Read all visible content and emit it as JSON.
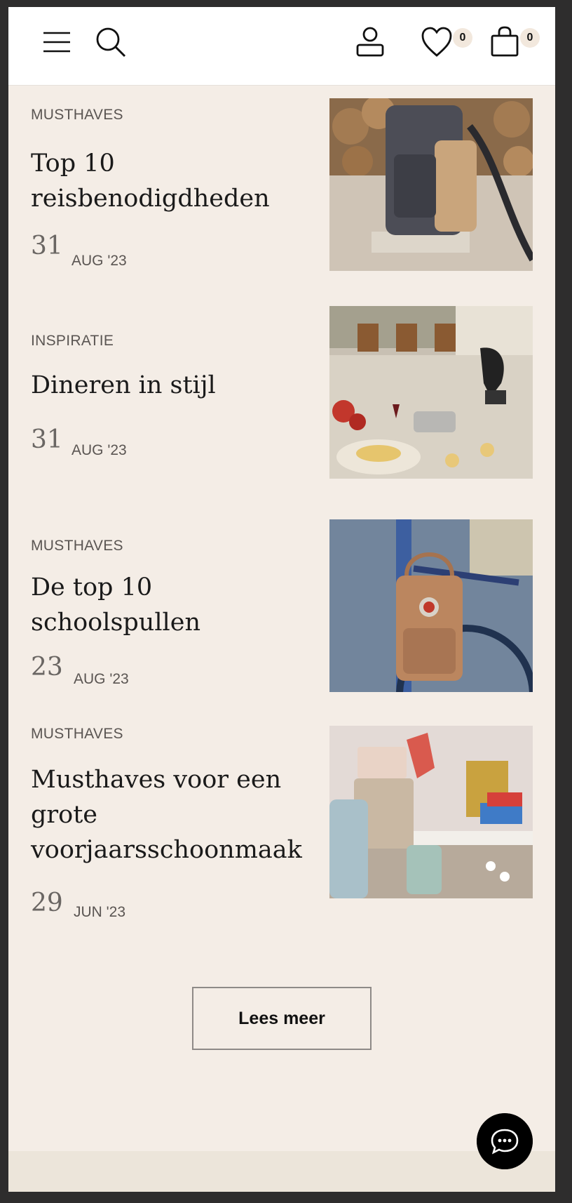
{
  "header": {
    "menu_icon": "hamburger-menu-icon",
    "search_icon": "search-icon",
    "account_icon": "user-icon",
    "wishlist_icon": "heart-icon",
    "wishlist_count": "0",
    "cart_icon": "shopping-bag-icon",
    "cart_count": "0"
  },
  "articles": [
    {
      "category": "MUSTHAVES",
      "title": "Top 10 reisbenodigdheden",
      "day": "31",
      "month": "AUG '23"
    },
    {
      "category": "INSPIRATIE",
      "title": "Dineren in stijl",
      "day": "31",
      "month": "AUG '23"
    },
    {
      "category": "MUSTHAVES",
      "title": "De top 10 schoolspullen",
      "day": "23",
      "month": "AUG '23"
    },
    {
      "category": "MUSTHAVES",
      "title": "Musthaves voor een grote voorjaarsschoonmaak",
      "day": "29",
      "month": "JUN '23"
    }
  ],
  "load_more_label": "Lees meer",
  "chat_icon": "chat-bubble-icon",
  "colors": {
    "page_background": "#f4ede6",
    "header_background": "#ffffff",
    "badge_background": "#f2e8dd",
    "outer_background": "#2e2d2d",
    "chat_button": "#000000"
  }
}
